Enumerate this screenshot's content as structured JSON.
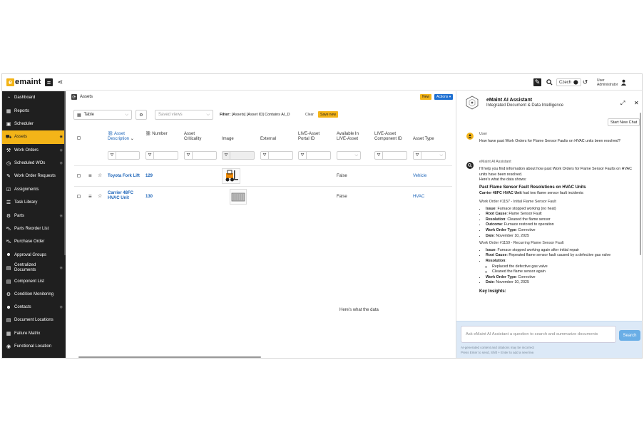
{
  "app": {
    "logo_mark": "e",
    "logo_text": "emaint",
    "language": "Czech",
    "user_line1": "User",
    "user_line2": "Administrator"
  },
  "sidebar": {
    "items": [
      {
        "label": "Dashboard",
        "icon": "dashboard-icon"
      },
      {
        "label": "Reports",
        "icon": "reports-icon"
      },
      {
        "label": "Scheduler",
        "icon": "calendar-icon"
      },
      {
        "label": "Assets",
        "icon": "truck-icon",
        "active": true
      },
      {
        "label": "Work Orders",
        "icon": "wrench-icon"
      },
      {
        "label": "Scheduled WOs",
        "icon": "clock-icon"
      },
      {
        "label": "Work Order Requests",
        "icon": "request-icon"
      },
      {
        "label": "Assignments",
        "icon": "clipboard-icon"
      },
      {
        "label": "Task Library",
        "icon": "list-icon"
      },
      {
        "label": "Parts",
        "icon": "gear-icon"
      },
      {
        "label": "Parts Reorder List",
        "icon": "cart-icon"
      },
      {
        "label": "Purchase Order",
        "icon": "cart-icon"
      },
      {
        "label": "Approval Groups",
        "icon": "group-icon"
      },
      {
        "label": "Centralized Documents",
        "icon": "document-icon"
      },
      {
        "label": "Component List",
        "icon": "document-icon"
      },
      {
        "label": "Condition Monitoring",
        "icon": "gear-icon"
      },
      {
        "label": "Contacts",
        "icon": "group-icon"
      },
      {
        "label": "Document Locations",
        "icon": "document-icon"
      },
      {
        "label": "Failure Matrix",
        "icon": "grid-icon"
      },
      {
        "label": "Functional Location",
        "icon": "location-icon"
      }
    ]
  },
  "main": {
    "breadcrumb": "Assets",
    "new_label": "New",
    "actions_label": "Actions",
    "view_select": "Table",
    "saved_views_placeholder": "Saved views",
    "filter_label": "Filter:",
    "filter_text": "[Assets] [Asset ID] Contains AI_D",
    "clear_label": "Clear",
    "save_new_label": "Save new",
    "columns": {
      "asset_description_1": "Asset",
      "asset_description_2": "Description",
      "number": "Number",
      "criticality_1": "Asset",
      "criticality_2": "Criticality",
      "image": "Image",
      "external": "External",
      "live_portal_1": "LIVE-Asset",
      "live_portal_2": "Portal ID",
      "available_1": "Available In",
      "available_2": "LIVE-Asset",
      "live_component_1": "LIVE-Asset",
      "live_component_2": "Component ID",
      "asset_type": "Asset Type"
    },
    "rows": [
      {
        "description": "Toyota Fork Lift",
        "number": "129",
        "available": "False",
        "type": "Vehicle"
      },
      {
        "description_1": "Carrier 48FC",
        "description_2": "HVAC Unit",
        "number": "130",
        "available": "False",
        "type": "HVAC"
      }
    ],
    "floating_text": "Here's what the data"
  },
  "ai": {
    "title": "eMaint AI Assistant",
    "subtitle": "Integrated Document & Data Intelligence",
    "start_new_chat": "Start New Chat",
    "user_name": "User",
    "user_question": "How have past Work Orders for Flame Sensor Faults on HVAC units been resolved?",
    "assistant_name": "eMaint AI Assistant",
    "intro": "I'll help you find information about how past Work Orders for Flame Sensor Faults on HVAC units have been resolved.",
    "data_shows": "Here's what the data shows:",
    "heading": "Past Flame Sensor Fault Resolutions on HVAC Units",
    "unit_bold": "Carrier 48FC HVAC Unit",
    "unit_rest": " had two flame sensor fault incidents:",
    "wo1_title": "Work Order #1157 - Initial Flame Sensor Fault",
    "wo1": [
      {
        "k": "Issue",
        "v": ": Furnace stopped working (no heat)"
      },
      {
        "k": "Root Cause",
        "v": ": Flame Sensor Fault"
      },
      {
        "k": "Resolution",
        "v": ": Cleaned the flame sensor"
      },
      {
        "k": "Outcome",
        "v": ": Furnace restored to operation"
      },
      {
        "k": "Work Order Type",
        "v": ": Corrective"
      },
      {
        "k": "Date",
        "v": ": November 10, 2025"
      }
    ],
    "wo2_title": "Work Order #1159 - Recurring Flame Sensor Fault",
    "wo2_issue_k": "Issue",
    "wo2_issue_v": ": Furnace stopped working again after initial repair",
    "wo2_cause_k": "Root Cause",
    "wo2_cause_v": ": Repeated flame sensor fault caused by a defective gas valve",
    "wo2_res_k": "Resolution",
    "wo2_res_v": ":",
    "wo2_sub": [
      "Replaced the defective gas valve",
      "Cleaned the flame sensor again"
    ],
    "wo2_type_k": "Work Order Type",
    "wo2_type_v": ": Corrective",
    "wo2_date_k": "Date",
    "wo2_date_v": ": November 10, 2025",
    "key_insights": "Key Insights:",
    "input_placeholder": "Ask eMaint AI Assistant a question to search and summarize documents",
    "search_label": "Search",
    "note_1": "AI-generated content and citations may be incorrect",
    "note_2": "Press Enter to send, Shift + Enter to add a new line."
  },
  "colors": {
    "brand_yellow": "#f3b418",
    "sidebar_bg": "#1f1f1f",
    "link_blue": "#1a63b8",
    "actions_blue": "#1d6fd1",
    "ai_footer": "#dce9f7"
  }
}
